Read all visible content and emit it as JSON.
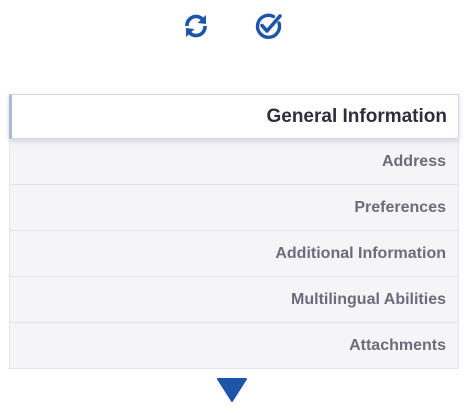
{
  "toolbar": {
    "refresh_icon": "refresh-icon",
    "check_icon": "check-circle-icon"
  },
  "tabs": [
    {
      "label": "General Information",
      "active": true
    },
    {
      "label": "Address",
      "active": false
    },
    {
      "label": "Preferences",
      "active": false
    },
    {
      "label": "Additional Information",
      "active": false
    },
    {
      "label": "Multilingual Abilities",
      "active": false
    },
    {
      "label": "Attachments",
      "active": false
    }
  ],
  "scroll": {
    "icon": "triangle-down-icon"
  },
  "colors": {
    "icon_blue": "#1d55a8",
    "active_text": "#2f2f3c",
    "inactive_text": "#6c6c7a",
    "tab_background": "#f5f5f7",
    "tab_border": "#e3e3e8"
  }
}
